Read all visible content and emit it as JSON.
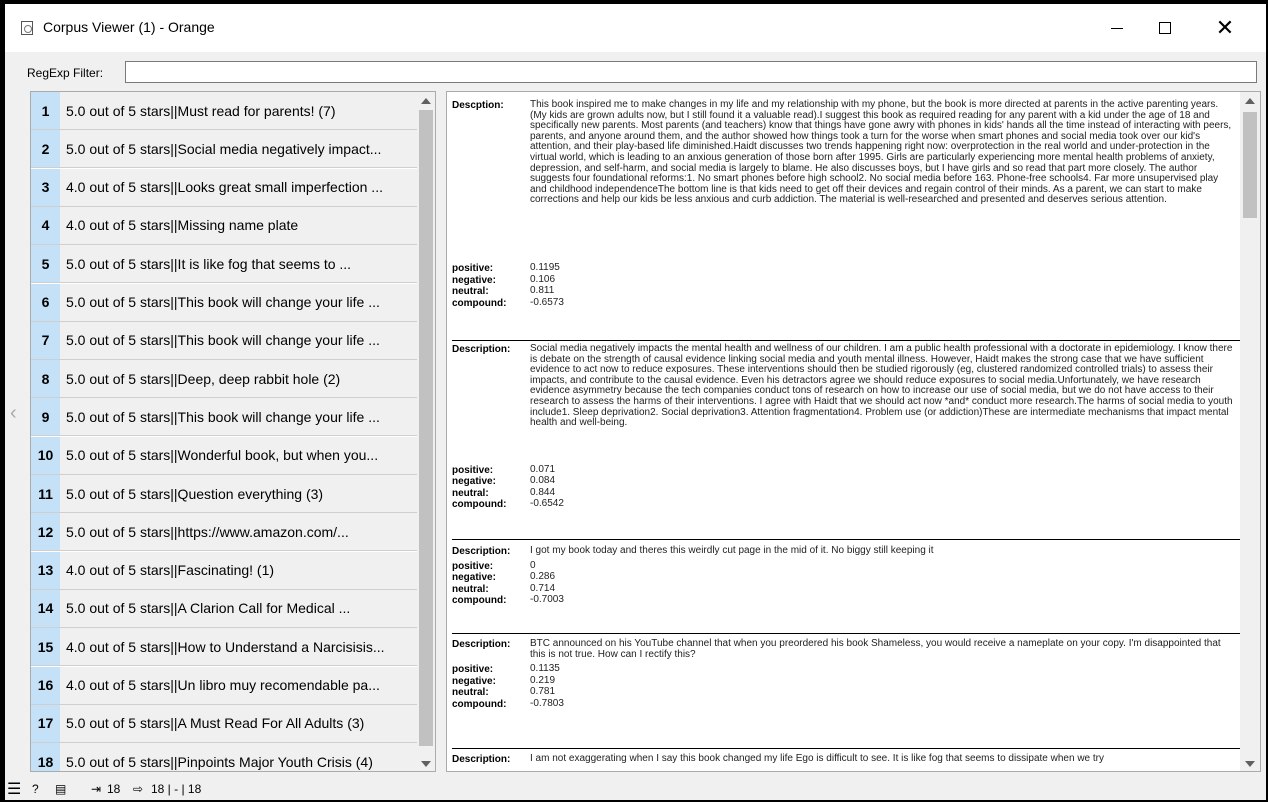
{
  "window": {
    "title": "Corpus Viewer (1) - Orange"
  },
  "filter": {
    "label": "RegExp Filter:",
    "value": ""
  },
  "documents": [
    {
      "num": "1",
      "title": "5.0 out of 5 stars||Must read for parents! (7)"
    },
    {
      "num": "2",
      "title": "5.0 out of 5 stars||Social media negatively impact..."
    },
    {
      "num": "3",
      "title": "4.0 out of 5 stars||Looks great small imperfection ..."
    },
    {
      "num": "4",
      "title": "4.0 out of 5 stars||Missing name plate"
    },
    {
      "num": "5",
      "title": "5.0 out of 5 stars||It is like fog that seems to ..."
    },
    {
      "num": "6",
      "title": "5.0 out of 5 stars||This book will change your life ..."
    },
    {
      "num": "7",
      "title": "5.0 out of 5 stars||This book will change your life ..."
    },
    {
      "num": "8",
      "title": "5.0 out of 5 stars||Deep, deep rabbit hole (2)"
    },
    {
      "num": "9",
      "title": "5.0 out of 5 stars||This book will change your life ..."
    },
    {
      "num": "10",
      "title": "5.0 out of 5 stars||Wonderful book, but when you..."
    },
    {
      "num": "11",
      "title": "5.0 out of 5 stars||Question everything (3)"
    },
    {
      "num": "12",
      "title": "5.0 out of 5 stars||https://www.amazon.com/..."
    },
    {
      "num": "13",
      "title": "4.0 out of 5 stars||Fascinating! (1)"
    },
    {
      "num": "14",
      "title": "5.0 out of 5 stars||A Clarion Call for Medical ..."
    },
    {
      "num": "15",
      "title": "4.0 out of 5 stars||How to Understand a Narcisisis..."
    },
    {
      "num": "16",
      "title": "4.0 out of 5 stars||Un libro muy recomendable pa..."
    },
    {
      "num": "17",
      "title": "5.0 out of 5 stars||A Must Read For All Adults (3)"
    },
    {
      "num": "18",
      "title": "5.0 out of 5 stars||Pinpoints Major Youth Crisis (4)"
    }
  ],
  "labels": {
    "description": "Descption:",
    "description_alt": "Description:",
    "positive": "positive:",
    "negative": "negative:",
    "neutral": "neutral:",
    "compound": "compound:"
  },
  "entries": [
    {
      "label": "Descption:",
      "description": "This book inspired me to make changes in my life and my relationship with my phone, but the book is more directed at parents in the active parenting years. (My kids are grown adults now, but I still found it a valuable read).I suggest this book as required reading for any parent with a kid under the age of 18 and specifically new parents. Most parents (and teachers) know that things have gone awry with phones in kids' hands all the time instead of interacting with peers, parents, and anyone around them, and the author showed how things took a turn for the worse when smart phones and social media took over our kid's attention, and their play-based life diminished.Haidt discusses two trends happening right now: overprotection in the real world and under-protection in the virtual world, which is leading to an anxious generation of those born after 1995. Girls are particularly experiencing  more mental health problems of anxiety, depression, and self-harm, and social media is largely to blame. He also discusses boys, but I have girls and so read that part more closely. The author suggests four foundational reforms:1. No smart phones before high school2. No social media before 163. Phone-free schools4. Far more unsupervised play and childhood independenceThe bottom line is that kids need to get off their devices and regain control of their minds. As a parent, we can start to make corrections and help our kids be less anxious and curb addiction. The material is well-researched and presented and deserves serious attention.",
      "positive": "0.1195",
      "negative": "0.106",
      "neutral": "0.811",
      "compound": "-0.6573"
    },
    {
      "label": "Description:",
      "description": "Social media negatively impacts the mental health and wellness of our children. I am a public health professional with a doctorate in epidemiology. I know there is debate on the strength of causal evidence linking social media and youth mental illness. However, Haidt makes the strong case that we have sufficient evidence to act now to reduce exposures. These interventions should then be studied rigorously (eg, clustered randomized controlled trials) to assess their impacts, and contribute to the causal evidence. Even his detractors agree we should reduce exposures to social media.Unfortunately, we have research evidence asymmetry because the tech companies conduct tons of research on how to increase our use of social media, but we do not have access to their research to assess the harms of their interventions. I agree with Haidt that we should act now *and* conduct more research.The harms of social media to youth include1. Sleep deprivation2. Social deprivation3. Attention fragmentation4. Problem use (or addiction)These are intermediate mechanisms that impact mental health and well-being.",
      "positive": "0.071",
      "negative": "0.084",
      "neutral": "0.844",
      "compound": "-0.6542"
    },
    {
      "label": "Description:",
      "description": "I got my book today and theres this weirdly cut page in the mid of it. No biggy still keeping it",
      "positive": "0",
      "negative": "0.286",
      "neutral": "0.714",
      "compound": "-0.7003"
    },
    {
      "label": "Description:",
      "description": "BTC announced on his YouTube channel that when you preordered his book Shameless, you would receive a nameplate on your copy. I'm disappointed that this is not true. How can I rectify this?",
      "positive": "0.1135",
      "negative": "0.219",
      "neutral": "0.781",
      "compound": "-0.7803"
    },
    {
      "label": "Description:",
      "description": "I am not exaggerating when I say this book changed my life Ego is difficult to see. It is like fog that seems to dissipate when we try"
    }
  ],
  "statusbar": {
    "matches_in": "18",
    "matches_out": "18 | - | 18"
  }
}
